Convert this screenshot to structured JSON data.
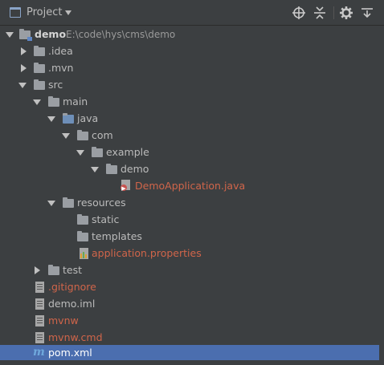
{
  "header": {
    "title": "Project",
    "icons": [
      "project-view-icon",
      "dropdown-arrow-icon",
      "locate-icon",
      "collapse-icon",
      "gear-icon",
      "hide-icon"
    ]
  },
  "tree": {
    "root": {
      "label": "demo",
      "path": "E:\\code\\hys\\cms\\demo"
    },
    "idea": ".idea",
    "mvn": ".mvn",
    "src": "src",
    "main": "main",
    "java": "java",
    "com": "com",
    "example": "example",
    "demo_pkg": "demo",
    "demo_app": "DemoApplication.java",
    "resources": "resources",
    "static": "static",
    "templates": "templates",
    "app_props": "application.properties",
    "test": "test",
    "gitignore": ".gitignore",
    "demo_iml": "demo.iml",
    "mvnw": "mvnw",
    "mvnw_cmd": "mvnw.cmd",
    "pom": "pom.xml"
  },
  "colors": {
    "background": "#3c3f41",
    "selection": "#4b6eaf",
    "untracked_file": "#d0654a",
    "text": "#bbbbbb"
  }
}
